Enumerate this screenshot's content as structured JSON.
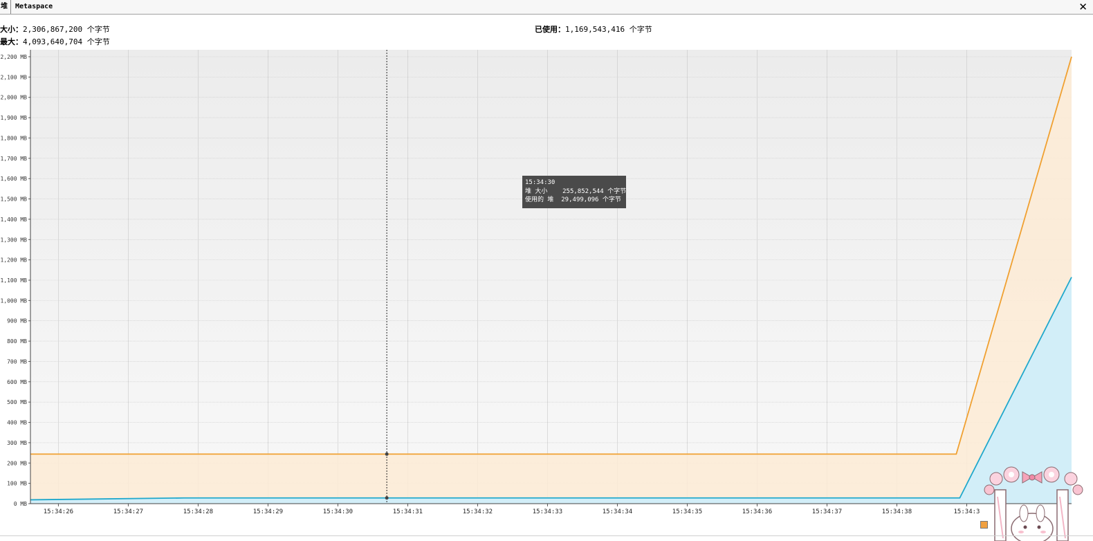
{
  "tabs": [
    {
      "label": "堆"
    },
    {
      "label": "Metaspace"
    }
  ],
  "stats": {
    "size_label": "大小：",
    "size_value": "2,306,867,200",
    "max_label": "最大：",
    "max_value": "4,093,640,704",
    "used_label": "已使用：",
    "used_value": "1,169,543,416",
    "unit": "个字节"
  },
  "tooltip": {
    "time": "15:34:30",
    "row1_label": "堆 大小",
    "row1_value": "255,852,544 个字节",
    "row2_label": "使用的 堆",
    "row2_value": "29,499,096 个字节"
  },
  "colors": {
    "size_line": "#f0a030",
    "size_fill": "#fdebd5",
    "used_line": "#20a8cc",
    "used_fill": "#d0eefa",
    "plot_bg_top": "#ececec",
    "plot_bg_bottom": "#f8f8f8",
    "grid": "#c8c8c8"
  },
  "chart_data": {
    "type": "area",
    "y_unit": "MB",
    "ylim": [
      0,
      2200
    ],
    "y_ticks": [
      0,
      100,
      200,
      300,
      400,
      500,
      600,
      700,
      800,
      900,
      1000,
      1100,
      1200,
      1300,
      1400,
      1500,
      1600,
      1700,
      1800,
      1900,
      2000,
      2100,
      2200
    ],
    "y_tick_labels": [
      "0 MB",
      "100 MB",
      "200 MB",
      "300 MB",
      "400 MB",
      "500 MB",
      "600 MB",
      "700 MB",
      "800 MB",
      "900 MB",
      "1,000 MB",
      "1,100 MB",
      "1,200 MB",
      "1,300 MB",
      "1,400 MB",
      "1,500 MB",
      "1,600 MB",
      "1,700 MB",
      "1,800 MB",
      "1,900 MB",
      "2,000 MB",
      "2,100 MB",
      "2,200 MB"
    ],
    "x_tick_labels": [
      "15:34:26",
      "15:34:27",
      "15:34:28",
      "15:34:29",
      "15:34:30",
      "15:34:31",
      "15:34:32",
      "15:34:33",
      "15:34:34",
      "15:34:35",
      "15:34:36",
      "15:34:37",
      "15:34:38",
      "15:34:3"
    ],
    "x_range_seconds": [
      25.6,
      40.5
    ],
    "x_tick_seconds": [
      26,
      27,
      28,
      29,
      30,
      31,
      32,
      33,
      34,
      35,
      36,
      37,
      38,
      39
    ],
    "crosshair_seconds": 30.7,
    "series": [
      {
        "name": "堆 大小",
        "x": [
          25.6,
          38.85,
          40.5
        ],
        "values": [
          244,
          244,
          2200
        ]
      },
      {
        "name": "使用的 堆",
        "x": [
          25.6,
          27.8,
          38.9,
          40.5
        ],
        "values": [
          19,
          28,
          28,
          1115
        ]
      }
    ]
  }
}
